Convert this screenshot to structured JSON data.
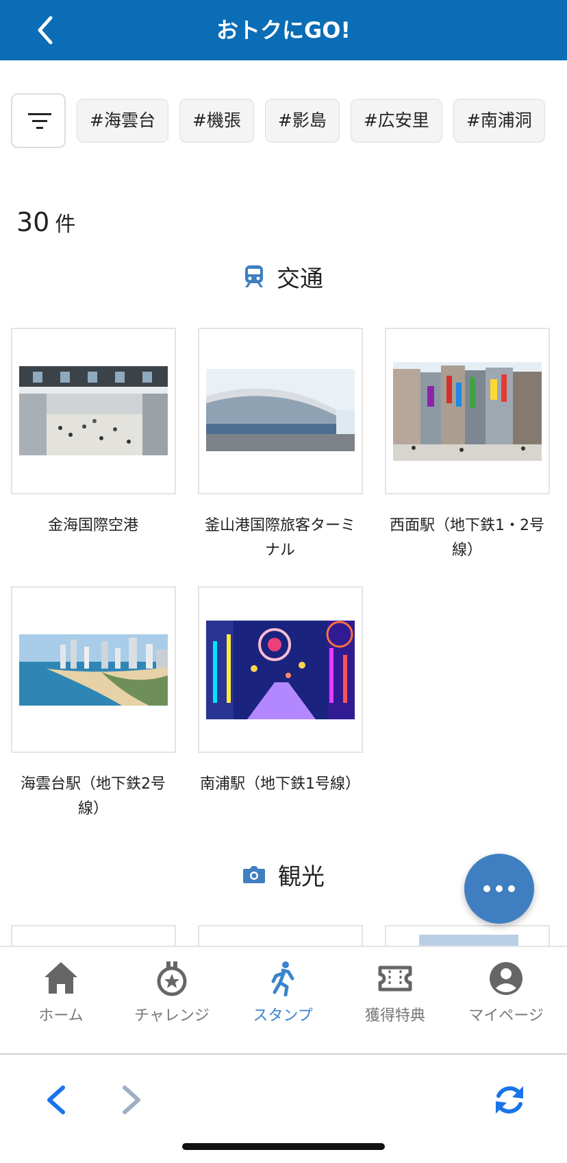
{
  "header": {
    "title": "おトクにGO!"
  },
  "tags": [
    "#海雲台",
    "#機張",
    "#影島",
    "#広安里",
    "#南浦洞"
  ],
  "count": {
    "number": "30",
    "unit": "件"
  },
  "sections": [
    {
      "label": "交通",
      "items": [
        {
          "caption_lines": [
            "金海国際空港"
          ]
        },
        {
          "caption_lines": [
            "釜山港国際旅客ターミ",
            "ナル"
          ]
        },
        {
          "caption_lines": [
            "西面駅（地下鉄1・2号",
            "線）"
          ]
        },
        {
          "caption_lines": [
            "海雲台駅（地下鉄2号",
            "線）"
          ]
        },
        {
          "caption_lines": [
            "南浦駅（地下鉄1号線）"
          ]
        }
      ]
    },
    {
      "label": "観光"
    }
  ],
  "tabbar": [
    {
      "label": "ホーム",
      "icon": "home-icon"
    },
    {
      "label": "チャレンジ",
      "icon": "medal-icon"
    },
    {
      "label": "スタンプ",
      "icon": "walking-icon",
      "active": true
    },
    {
      "label": "獲得特典",
      "icon": "ticket-icon"
    },
    {
      "label": "マイページ",
      "icon": "user-icon"
    }
  ],
  "colors": {
    "header": "#0a6db5",
    "accent": "#3a85cc",
    "fab": "#3f7fc1"
  }
}
